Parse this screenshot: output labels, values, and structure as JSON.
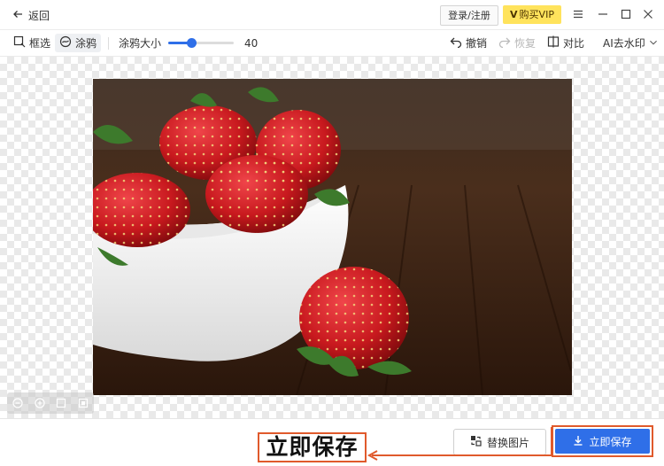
{
  "titlebar": {
    "back_label": "返回",
    "login_label": "登录/注册",
    "vip_label": "购买VIP",
    "vip_mark": "V"
  },
  "toolbar": {
    "box_select_label": "框选",
    "brush_label": "涂鸦",
    "brush_size_label": "涂鸦大小",
    "brush_size_value": "40",
    "brush_size_fraction": 0.35,
    "undo_label": "撤销",
    "redo_label": "恢复",
    "compare_label": "对比",
    "ai_label": "AI去水印"
  },
  "bottom": {
    "replace_label": "替换图片",
    "save_label": "立即保存",
    "annotation_label": "立即保存"
  },
  "colors": {
    "accent": "#2f6fe8",
    "vip": "#ffe35c",
    "annotation": "#e05a2c"
  },
  "icons": [
    "back-arrow-icon",
    "menu-icon",
    "minimize-icon",
    "maximize-icon",
    "close-icon",
    "box-select-icon",
    "brush-icon",
    "undo-icon",
    "redo-icon",
    "compare-icon",
    "chevron-down-icon",
    "zoom-out-icon",
    "zoom-in-icon",
    "fit-icon",
    "actual-size-icon",
    "replace-icon",
    "download-icon"
  ]
}
